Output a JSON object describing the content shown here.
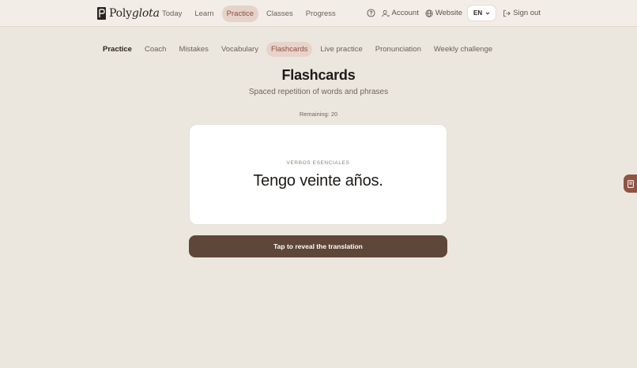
{
  "brand": {
    "name_prefix": "Poly",
    "name_suffix": "glota"
  },
  "topnav": [
    {
      "label": "Today",
      "active": false
    },
    {
      "label": "Learn",
      "active": false
    },
    {
      "label": "Practice",
      "active": true
    },
    {
      "label": "Classes",
      "active": false
    },
    {
      "label": "Progress",
      "active": false
    }
  ],
  "tools": {
    "account": "Account",
    "website": "Website",
    "language": "EN",
    "signout": "Sign out"
  },
  "subnav": [
    {
      "label": "Practice",
      "active": false
    },
    {
      "label": "Coach",
      "active": false
    },
    {
      "label": "Mistakes",
      "active": false
    },
    {
      "label": "Vocabulary",
      "active": false
    },
    {
      "label": "Flashcards",
      "active": true
    },
    {
      "label": "Live practice",
      "active": false
    },
    {
      "label": "Pronunciation",
      "active": false
    },
    {
      "label": "Weekly challenge",
      "active": false
    }
  ],
  "page": {
    "title": "Flashcards",
    "subtitle": "Spaced repetition of words and phrases",
    "remaining": "Remaining: 20"
  },
  "card": {
    "deck": "VERBOS ESENCIALES",
    "phrase": "Tengo veinte años."
  },
  "reveal_label": "Tap to reveal the translation",
  "icons": [
    "help-icon",
    "account-icon",
    "globe-icon",
    "chevron-down-icon",
    "signout-icon",
    "flashcard-icon"
  ],
  "colors": {
    "accent": "#5e4638",
    "active_bg": "#e8d3ca",
    "active_text": "#8a4e3c",
    "side_tab": "#8f5443"
  }
}
